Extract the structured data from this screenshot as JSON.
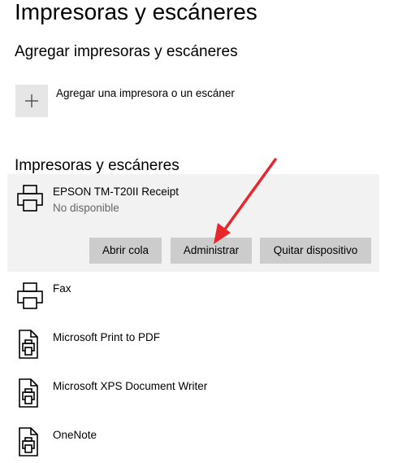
{
  "page": {
    "title": "Impresoras y escáneres"
  },
  "add_section": {
    "title": "Agregar impresoras y escáneres",
    "add_button_label": "Agregar una impresora o un escáner"
  },
  "devices_section": {
    "title": "Impresoras y escáneres",
    "devices": [
      {
        "name": "EPSON TM-T20II Receipt",
        "status": "No disponible",
        "icon": "printer-icon"
      },
      {
        "name": "Fax",
        "icon": "printer-icon"
      },
      {
        "name": "Microsoft Print to PDF",
        "icon": "document-printer-icon"
      },
      {
        "name": "Microsoft XPS Document Writer",
        "icon": "document-printer-icon"
      },
      {
        "name": "OneNote",
        "icon": "document-printer-icon"
      }
    ],
    "actions": {
      "open_queue": "Abrir cola",
      "manage": "Administrar",
      "remove_device": "Quitar dispositivo"
    }
  },
  "colors": {
    "selected_background": "#f2f2f2",
    "button_background": "#cccccc",
    "tile_background": "#e6e6e6",
    "secondary_text": "#666666",
    "annotation_arrow": "#e8262b"
  }
}
